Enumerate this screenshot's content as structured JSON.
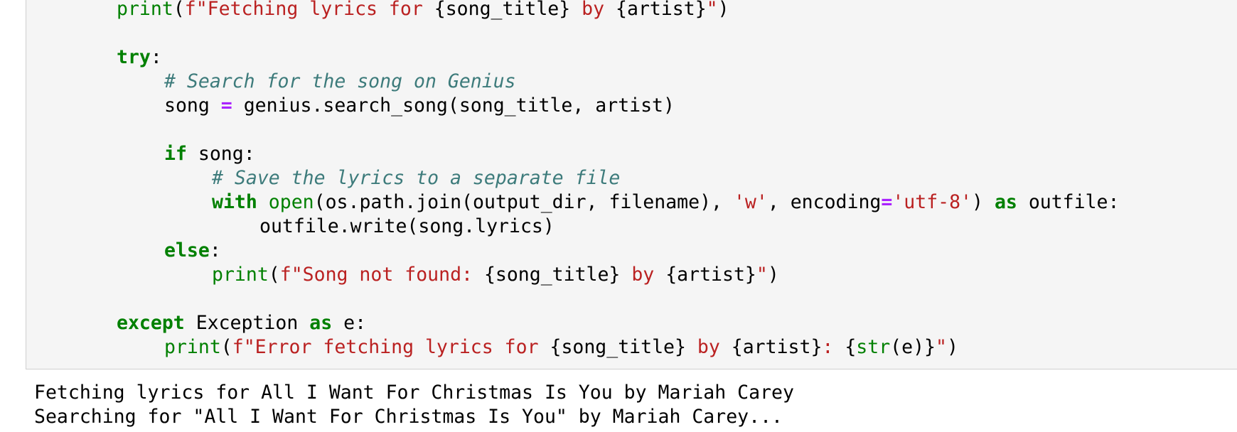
{
  "colors": {
    "keyword": "#008000",
    "builtin": "#008000",
    "string": "#ba2121",
    "operator": "#aa22ff",
    "comment": "#3d7b7b",
    "text": "#000000",
    "cell_background": "#f5f5f5",
    "cell_border": "#cfcfcf"
  },
  "code_cell": {
    "lines": [
      {
        "indent": 2,
        "tokens": [
          {
            "t": "fn",
            "v": "print"
          },
          {
            "t": "tx",
            "v": "("
          },
          {
            "t": "str",
            "v": "f\"Fetching lyrics for "
          },
          {
            "t": "tx",
            "v": "{song_title}"
          },
          {
            "t": "str",
            "v": " by "
          },
          {
            "t": "tx",
            "v": "{artist}"
          },
          {
            "t": "str",
            "v": "\""
          },
          {
            "t": "tx",
            "v": ")"
          }
        ]
      },
      {
        "indent": 0,
        "tokens": []
      },
      {
        "indent": 2,
        "tokens": [
          {
            "t": "kw",
            "v": "try"
          },
          {
            "t": "tx",
            "v": ":"
          }
        ]
      },
      {
        "indent": 3,
        "tokens": [
          {
            "t": "cm",
            "v": "# Search for the song on Genius"
          }
        ]
      },
      {
        "indent": 3,
        "tokens": [
          {
            "t": "tx",
            "v": "song "
          },
          {
            "t": "op",
            "v": "="
          },
          {
            "t": "tx",
            "v": " genius.search_song(song_title, artist)"
          }
        ]
      },
      {
        "indent": 0,
        "tokens": []
      },
      {
        "indent": 3,
        "tokens": [
          {
            "t": "kw",
            "v": "if"
          },
          {
            "t": "tx",
            "v": " song:"
          }
        ]
      },
      {
        "indent": 4,
        "tokens": [
          {
            "t": "cm",
            "v": "# Save the lyrics to a separate file"
          }
        ]
      },
      {
        "indent": 4,
        "tokens": [
          {
            "t": "kw",
            "v": "with"
          },
          {
            "t": "tx",
            "v": " "
          },
          {
            "t": "fn",
            "v": "open"
          },
          {
            "t": "tx",
            "v": "(os.path.join(output_dir, filename), "
          },
          {
            "t": "str",
            "v": "'w'"
          },
          {
            "t": "tx",
            "v": ", encoding"
          },
          {
            "t": "op",
            "v": "="
          },
          {
            "t": "str",
            "v": "'utf-8'"
          },
          {
            "t": "tx",
            "v": ") "
          },
          {
            "t": "kw",
            "v": "as"
          },
          {
            "t": "tx",
            "v": " outfile:"
          }
        ]
      },
      {
        "indent": 5,
        "tokens": [
          {
            "t": "tx",
            "v": "outfile.write(song.lyrics)"
          }
        ]
      },
      {
        "indent": 3,
        "tokens": [
          {
            "t": "kw",
            "v": "else"
          },
          {
            "t": "tx",
            "v": ":"
          }
        ]
      },
      {
        "indent": 4,
        "tokens": [
          {
            "t": "fn",
            "v": "print"
          },
          {
            "t": "tx",
            "v": "("
          },
          {
            "t": "str",
            "v": "f\"Song not found: "
          },
          {
            "t": "tx",
            "v": "{song_title}"
          },
          {
            "t": "str",
            "v": " by "
          },
          {
            "t": "tx",
            "v": "{artist}"
          },
          {
            "t": "str",
            "v": "\""
          },
          {
            "t": "tx",
            "v": ")"
          }
        ]
      },
      {
        "indent": 0,
        "tokens": []
      },
      {
        "indent": 2,
        "tokens": [
          {
            "t": "kw",
            "v": "except"
          },
          {
            "t": "tx",
            "v": " Exception "
          },
          {
            "t": "kw",
            "v": "as"
          },
          {
            "t": "tx",
            "v": " e:"
          }
        ]
      },
      {
        "indent": 3,
        "tokens": [
          {
            "t": "fn",
            "v": "print"
          },
          {
            "t": "tx",
            "v": "("
          },
          {
            "t": "str",
            "v": "f\"Error fetching lyrics for "
          },
          {
            "t": "tx",
            "v": "{song_title}"
          },
          {
            "t": "str",
            "v": " by "
          },
          {
            "t": "tx",
            "v": "{artist}"
          },
          {
            "t": "str",
            "v": ": "
          },
          {
            "t": "tx",
            "v": "{"
          },
          {
            "t": "fn",
            "v": "str"
          },
          {
            "t": "tx",
            "v": "(e)}"
          },
          {
            "t": "str",
            "v": "\""
          },
          {
            "t": "tx",
            "v": ")"
          }
        ]
      }
    ]
  },
  "output": {
    "lines": [
      "Fetching lyrics for All I Want For Christmas Is You by Mariah Carey",
      "Searching for \"All I Want For Christmas Is You\" by Mariah Carey..."
    ]
  }
}
